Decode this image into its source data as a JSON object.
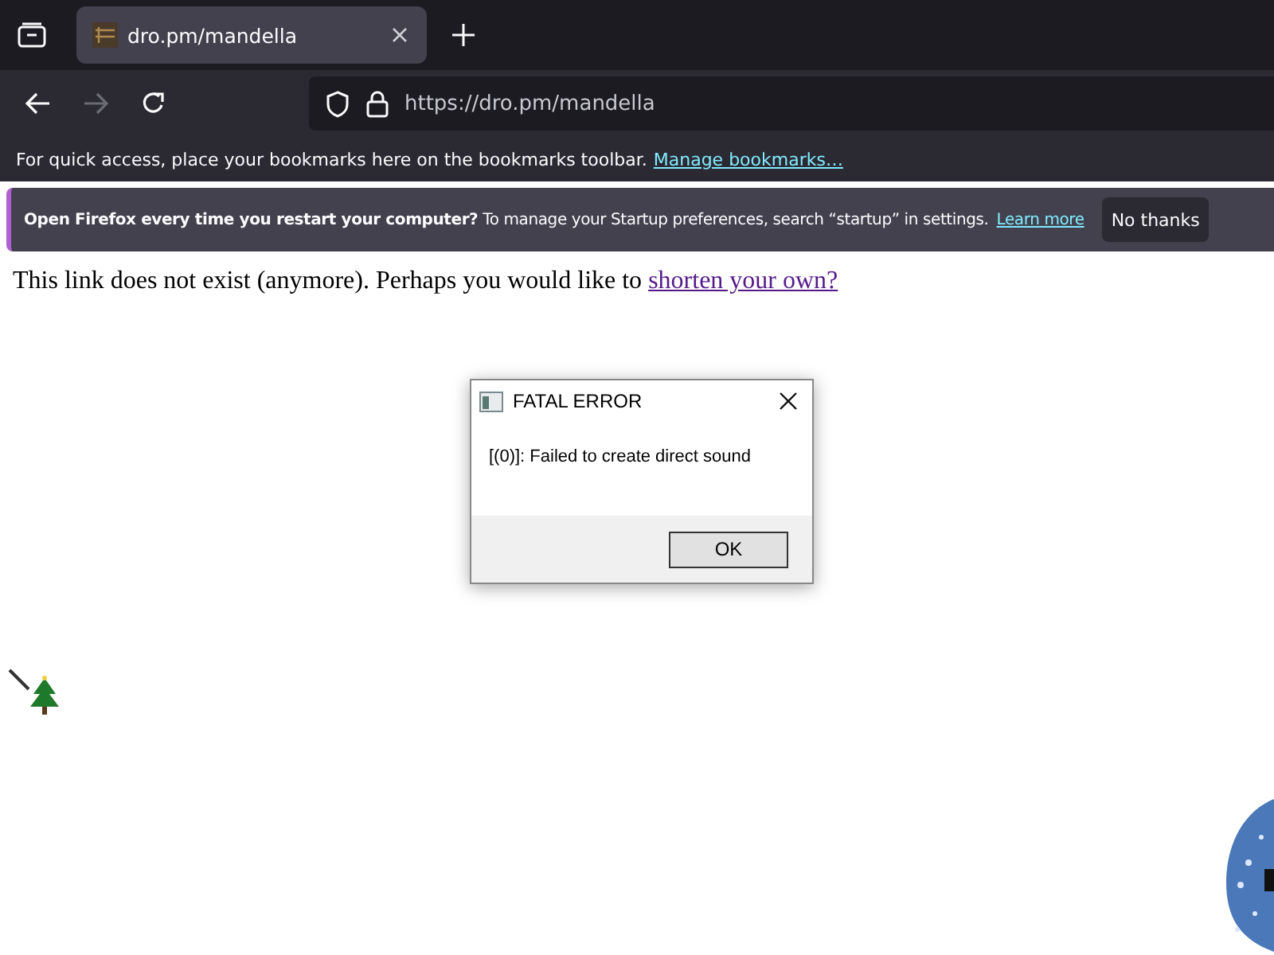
{
  "tabs": [
    {
      "title": "dro.pm/mandella",
      "selected": true
    }
  ],
  "address_bar": {
    "url": "https://dro.pm/mandella"
  },
  "bookmarks_toolbar": {
    "text": "For quick access, place your bookmarks here on the bookmarks toolbar.",
    "link": "Manage bookmarks…"
  },
  "notification": {
    "text": "**Open Firefox every time you restart your computer?** To manage your Startup preferences, search “startup” in settings.",
    "link": "Learn more",
    "button": "No thanks"
  },
  "page": {
    "text": "This link does not exist (anymore). Perhaps you would like to",
    "link": "shorten your own?"
  },
  "dialog": {
    "title": "FATAL ERROR",
    "message": "[(0)]: Failed to create direct sound",
    "button": "OK"
  }
}
